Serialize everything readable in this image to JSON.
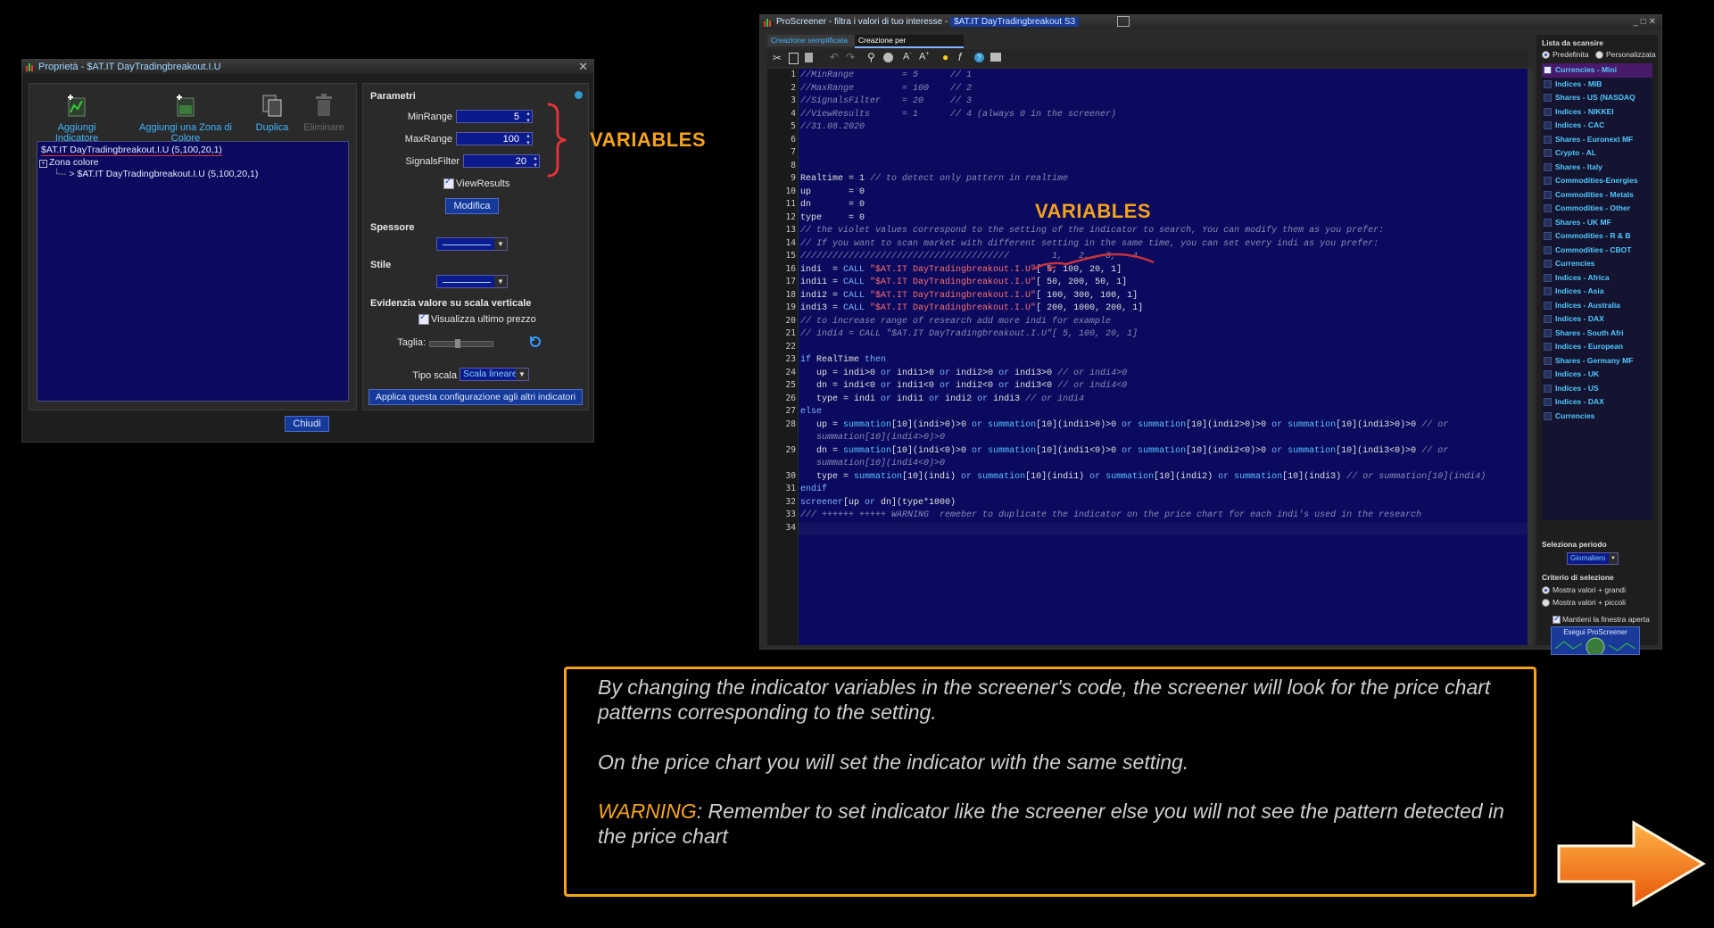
{
  "props_window": {
    "title": "Proprietà - $AT.IT DayTradingbreakout.I.U",
    "close": "✕",
    "toolbar": [
      {
        "label": "Aggiungi Indicatore",
        "icon": "add-indicator-icon"
      },
      {
        "label": "Aggiungi una Zona di Colore",
        "icon": "add-color-zone-icon"
      },
      {
        "label": "Duplica",
        "icon": "duplicate-icon"
      },
      {
        "label": "Eliminare",
        "icon": "trash-icon"
      }
    ],
    "tree": {
      "root": "$AT.IT DayTradingbreakout.I.U (5,100,20,1)",
      "zone": "Zona colore",
      "child": "> $AT.IT DayTradingbreakout.I.U (5,100,20,1)"
    },
    "close_button": "Chiudi",
    "params": {
      "heading": "Parametri",
      "minrange_label": "MinRange",
      "minrange_value": "5",
      "maxrange_label": "MaxRange",
      "maxrange_value": "100",
      "signals_label": "SignalsFilter",
      "signals_value": "20",
      "viewresults_label": "ViewResults",
      "modify_button": "Modifica",
      "spessore": "Spessore",
      "stile": "Stile",
      "evidenzia": "Evidenzia valore su scala verticale",
      "visualizza": "Visualizza ultimo prezzo",
      "taglia": "Taglia:",
      "tipo_scala": "Tipo scala",
      "scala_value": "Scala lineare",
      "apply_button": "Applica questa configurazione agli altri indicatori"
    }
  },
  "annotation_left": "VARIABLES",
  "annotation_code": "VARIABLES",
  "screener": {
    "title": "ProScreener - filtra i valori di tuo interesse -",
    "title_doc": "$AT.IT DayTradingbreakout S3",
    "tabs": [
      "Creazione semplificata",
      "Creazione per Programmazione"
    ],
    "window_controls": "_ □ ✕",
    "list_heading": "Lista da scansire",
    "radio_predefinita": "Predefinita",
    "radio_personalizzata": "Personalizzata",
    "list_items": [
      "Currencies - Mini",
      "Indices - MIB",
      "Shares - US (NASDAQ",
      "Indices - NIKKEI",
      "Indices - CAC",
      "Shares - Euronext MF",
      "Crypto - AL",
      "Shares - Italy",
      "Commodities-Energies",
      "Commodities - Metals",
      "Commodities - Other",
      "Shares - UK MF",
      "Commodities - R & B",
      "Commodities - CBOT",
      "Currencies",
      "Indices - Africa",
      "Indices - Asia",
      "Indices - Australia",
      "Indices - DAX",
      "Shares - South Afri",
      "Indices - European",
      "Shares - Germany MF",
      "Indices - UK",
      "Indices - US",
      "Indices - DAX",
      "Currencies"
    ],
    "period_heading": "Seleziona periodo",
    "period_value": "Giornaliero",
    "criteria_heading": "Criterio di selezione",
    "criteria_high": "Mostra valori + grandi",
    "criteria_low": "Mostra valori + piccoli",
    "keep_open": "Mantieni la finestra aperta",
    "run_button": "Esegui ProScreener",
    "line_numbers": [
      "1",
      "2",
      "3",
      "4",
      "5",
      "6",
      "7",
      "8",
      "9",
      "10",
      "11",
      "12",
      "13",
      "14",
      "15",
      "16",
      "17",
      "18",
      "19",
      "20",
      "21",
      "22",
      "23",
      "24",
      "25",
      "26",
      "27",
      "28",
      "",
      "29",
      "",
      "30",
      "31",
      "32",
      "33",
      "34"
    ],
    "code": [
      [
        [
          "c",
          "//MinRange         = 5      // 1"
        ]
      ],
      [
        [
          "c",
          "//MaxRange         = 100    // 2"
        ]
      ],
      [
        [
          "c",
          "//SignalsFilter    = 20     // 3"
        ]
      ],
      [
        [
          "c",
          "//ViewResults      = 1      // 4 (always 0 in the screener)"
        ]
      ],
      [
        [
          "c",
          "//31.08.2020"
        ]
      ],
      [],
      [],
      [],
      [
        [
          "w",
          "Realtime = 1 "
        ],
        [
          "c",
          "// to detect only pattern in realtime"
        ]
      ],
      [
        [
          "w",
          "up       = 0"
        ]
      ],
      [
        [
          "w",
          "dn       = 0"
        ]
      ],
      [
        [
          "w",
          "type     = 0"
        ]
      ],
      [
        [
          "c",
          "// the violet values correspond to the setting of the indicator to search, You can modify them as you prefer:"
        ]
      ],
      [
        [
          "c",
          "// If you want to scan market with different setting in the same time, you can set every indi as you prefer:"
        ]
      ],
      [
        [
          "c",
          "///////////////////////////////////////        1,   2,   3,   4"
        ]
      ],
      [
        [
          "w",
          "indi  = "
        ],
        [
          "k",
          "CALL "
        ],
        [
          "r",
          "\"$AT.IT DayTradingbreakout.I.U\""
        ],
        [
          "w",
          "[ 5, 100, 20, 1]"
        ]
      ],
      [
        [
          "w",
          "indi1 = "
        ],
        [
          "k",
          "CALL "
        ],
        [
          "r",
          "\"$AT.IT DayTradingbreakout.I.U\""
        ],
        [
          "w",
          "[ 50, 200, 50, 1]"
        ]
      ],
      [
        [
          "w",
          "indi2 = "
        ],
        [
          "k",
          "CALL "
        ],
        [
          "r",
          "\"$AT.IT DayTradingbreakout.I.U\""
        ],
        [
          "w",
          "[ 100, 300, 100, 1]"
        ]
      ],
      [
        [
          "w",
          "indi3 = "
        ],
        [
          "k",
          "CALL "
        ],
        [
          "r",
          "\"$AT.IT DayTradingbreakout.I.U\""
        ],
        [
          "w",
          "[ 200, 1000, 200, 1]"
        ]
      ],
      [
        [
          "c",
          "// to increase range of research add more indi for example"
        ]
      ],
      [
        [
          "c",
          "// indi4 = CALL \"$AT.IT DayTradingbreakout.I.U\"[ 5, 100, 20, 1]"
        ]
      ],
      [],
      [
        [
          "k",
          "if "
        ],
        [
          "w",
          "RealTime "
        ],
        [
          "k",
          "then"
        ]
      ],
      [
        [
          "w",
          "   up = indi>0 "
        ],
        [
          "k",
          "or "
        ],
        [
          "w",
          "indi1>0 "
        ],
        [
          "k",
          "or "
        ],
        [
          "w",
          "indi2>0 "
        ],
        [
          "k",
          "or "
        ],
        [
          "w",
          "indi3>0 "
        ],
        [
          "c",
          "// or indi4>0"
        ]
      ],
      [
        [
          "w",
          "   dn = indi<0 "
        ],
        [
          "k",
          "or "
        ],
        [
          "w",
          "indi1<0 "
        ],
        [
          "k",
          "or "
        ],
        [
          "w",
          "indi2<0 "
        ],
        [
          "k",
          "or "
        ],
        [
          "w",
          "indi3<0 "
        ],
        [
          "c",
          "// or indi4<0"
        ]
      ],
      [
        [
          "w",
          "   type = indi "
        ],
        [
          "k",
          "or "
        ],
        [
          "w",
          "indi1 "
        ],
        [
          "k",
          "or "
        ],
        [
          "w",
          "indi2 "
        ],
        [
          "k",
          "or "
        ],
        [
          "w",
          "indi3 "
        ],
        [
          "c",
          "// or indi4"
        ]
      ],
      [
        [
          "k",
          "else"
        ]
      ],
      [
        [
          "w",
          "   up = "
        ],
        [
          "f",
          "summation"
        ],
        [
          "w",
          "[10](indi>0)>0 "
        ],
        [
          "k",
          "or "
        ],
        [
          "f",
          "summation"
        ],
        [
          "w",
          "[10](indi1>0)>0 "
        ],
        [
          "k",
          "or "
        ],
        [
          "f",
          "summation"
        ],
        [
          "w",
          "[10](indi2>0)>0 "
        ],
        [
          "k",
          "or "
        ],
        [
          "f",
          "summation"
        ],
        [
          "w",
          "[10](indi3>0)>0 "
        ],
        [
          "c",
          "// or"
        ]
      ],
      [
        [
          "c",
          "   summation[10](indi4>0)>0"
        ]
      ],
      [
        [
          "w",
          "   dn = "
        ],
        [
          "f",
          "summation"
        ],
        [
          "w",
          "[10](indi<0)>0 "
        ],
        [
          "k",
          "or "
        ],
        [
          "f",
          "summation"
        ],
        [
          "w",
          "[10](indi1<0)>0 "
        ],
        [
          "k",
          "or "
        ],
        [
          "f",
          "summation"
        ],
        [
          "w",
          "[10](indi2<0)>0 "
        ],
        [
          "k",
          "or "
        ],
        [
          "f",
          "summation"
        ],
        [
          "w",
          "[10](indi3<0)>0 "
        ],
        [
          "c",
          "// or"
        ]
      ],
      [
        [
          "c",
          "   summation[10](indi4<0)>0"
        ]
      ],
      [
        [
          "w",
          "   type = "
        ],
        [
          "f",
          "summation"
        ],
        [
          "w",
          "[10](indi) "
        ],
        [
          "k",
          "or "
        ],
        [
          "f",
          "summation"
        ],
        [
          "w",
          "[10](indi1) "
        ],
        [
          "k",
          "or "
        ],
        [
          "f",
          "summation"
        ],
        [
          "w",
          "[10](indi2) "
        ],
        [
          "k",
          "or "
        ],
        [
          "f",
          "summation"
        ],
        [
          "w",
          "[10](indi3) "
        ],
        [
          "c",
          "// or summation[10](indi4)"
        ]
      ],
      [
        [
          "k",
          "endif"
        ]
      ],
      [
        [
          "k",
          "screener"
        ],
        [
          "w",
          "[up "
        ],
        [
          "k",
          "or "
        ],
        [
          "w",
          "dn](type*1000)"
        ]
      ],
      [
        [
          "c",
          "/// ++++++ +++++ WARNING  remeber to duplicate the indicator on the price chart for each indi's used in the research"
        ]
      ],
      []
    ]
  },
  "info": {
    "p1": "By changing the indicator variables in the screener's code, the screener will look for the price chart  patterns corresponding to the setting.",
    "p2": "On the price chart you will set the indicator with the same setting.",
    "warning_word": "WARNING",
    "p3": ": Remember to set indicator like the screener else you will not see the pattern detected in the price chart"
  },
  "colors": {
    "accent": "#f5a31a",
    "code_bg": "#0a0a5e",
    "link": "#3fb6ff"
  }
}
